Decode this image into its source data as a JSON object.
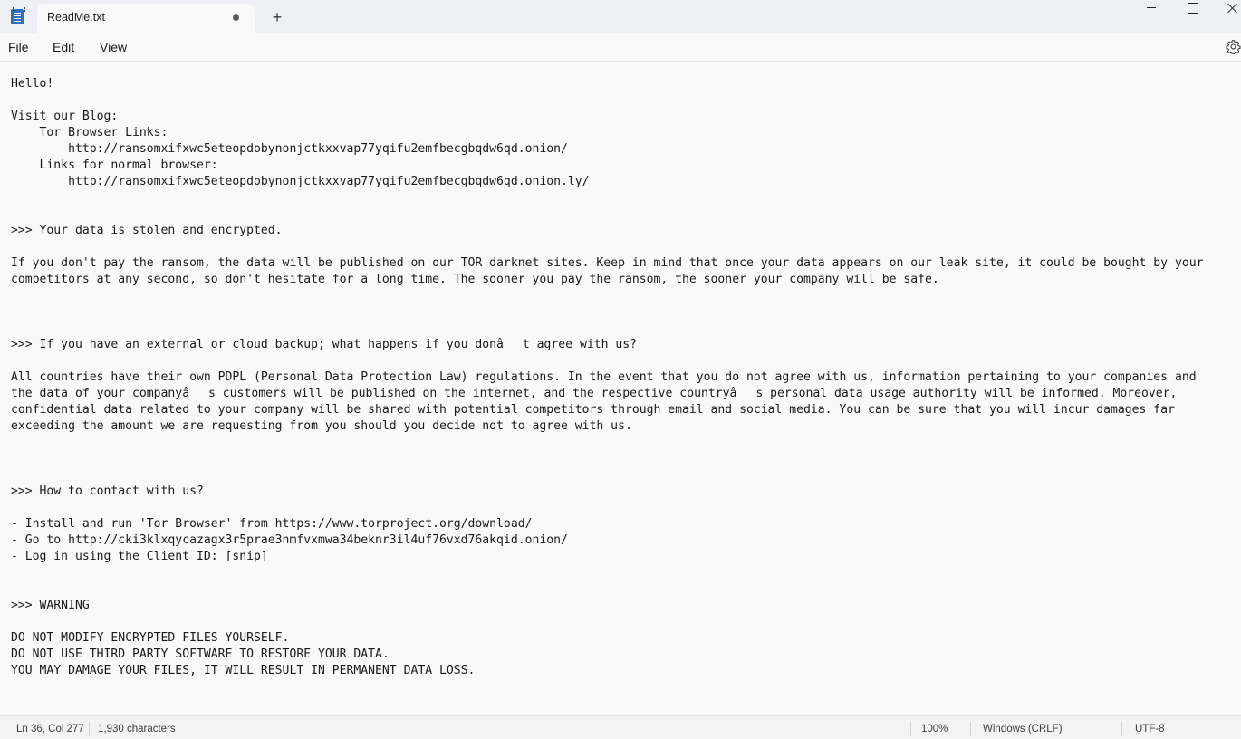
{
  "window": {
    "tab_title": "ReadMe.txt",
    "new_tab_label": "+",
    "unsaved_indicator": "modified-dot"
  },
  "menu": {
    "file": "File",
    "edit": "Edit",
    "view": "View"
  },
  "editor": {
    "content": "Hello!\n\nVisit our Blog:\n    Tor Browser Links:\n        http://ransomxifxwc5eteopdobynonjctkxxvap77yqifu2emfbecgbqdw6qd.onion/\n    Links for normal browser:\n        http://ransomxifxwc5eteopdobynonjctkxxvap77yqifu2emfbecgbqdw6qd.onion.ly/\n\n\n>>> Your data is stolen and encrypted.\n\nIf you don't pay the ransom, the data will be published on our TOR darknet sites. Keep in mind that once your data appears on our leak site, it could be bought by your\ncompetitors at any second, so don't hesitate for a long time. The sooner you pay the ransom, the sooner your company will be safe.\n\n\n\n>>> If you have an external or cloud backup; what happens if you donât agree with us?\n\nAll countries have their own PDPL (Personal Data Protection Law) regulations. In the event that you do not agree with us, information pertaining to your companies and\nthe data of your companyâs customers will be published on the internet, and the respective countryâs personal data usage authority will be informed. Moreover,\nconfidential data related to your company will be shared with potential competitors through email and social media. You can be sure that you will incur damages far\nexceeding the amount we are requesting from you should you decide not to agree with us.\n\n\n\n>>> How to contact with us?\n\n- Install and run 'Tor Browser' from https://www.torproject.org/download/\n- Go to http://cki3klxqycazagx3r5prae3nmfvxmwa34beknr3il4uf76vxd76akqid.onion/\n- Log in using the Client ID: [snip]\n\n\n>>> WARNING\n\nDO NOT MODIFY ENCRYPTED FILES YOURSELF.\nDO NOT USE THIRD PARTY SOFTWARE TO RESTORE YOUR DATA.\nYOU MAY DAMAGE YOUR FILES, IT WILL RESULT IN PERMANENT DATA LOSS."
  },
  "status": {
    "position": "Ln 36, Col 277",
    "characters": "1,930 characters",
    "zoom": "100%",
    "line_ending": "Windows (CRLF)",
    "encoding": "UTF-8"
  },
  "icons": {
    "app": "notepad-icon",
    "settings": "gear-icon",
    "minimize": "minimize-icon",
    "maximize": "maximize-icon",
    "close": "close-icon"
  },
  "colors": {
    "titlebar_bg": "#eef0f5",
    "editor_bg": "#f9f9f9",
    "statusbar_bg": "#f3f3f3",
    "app_icon": "#2f6fbd"
  }
}
